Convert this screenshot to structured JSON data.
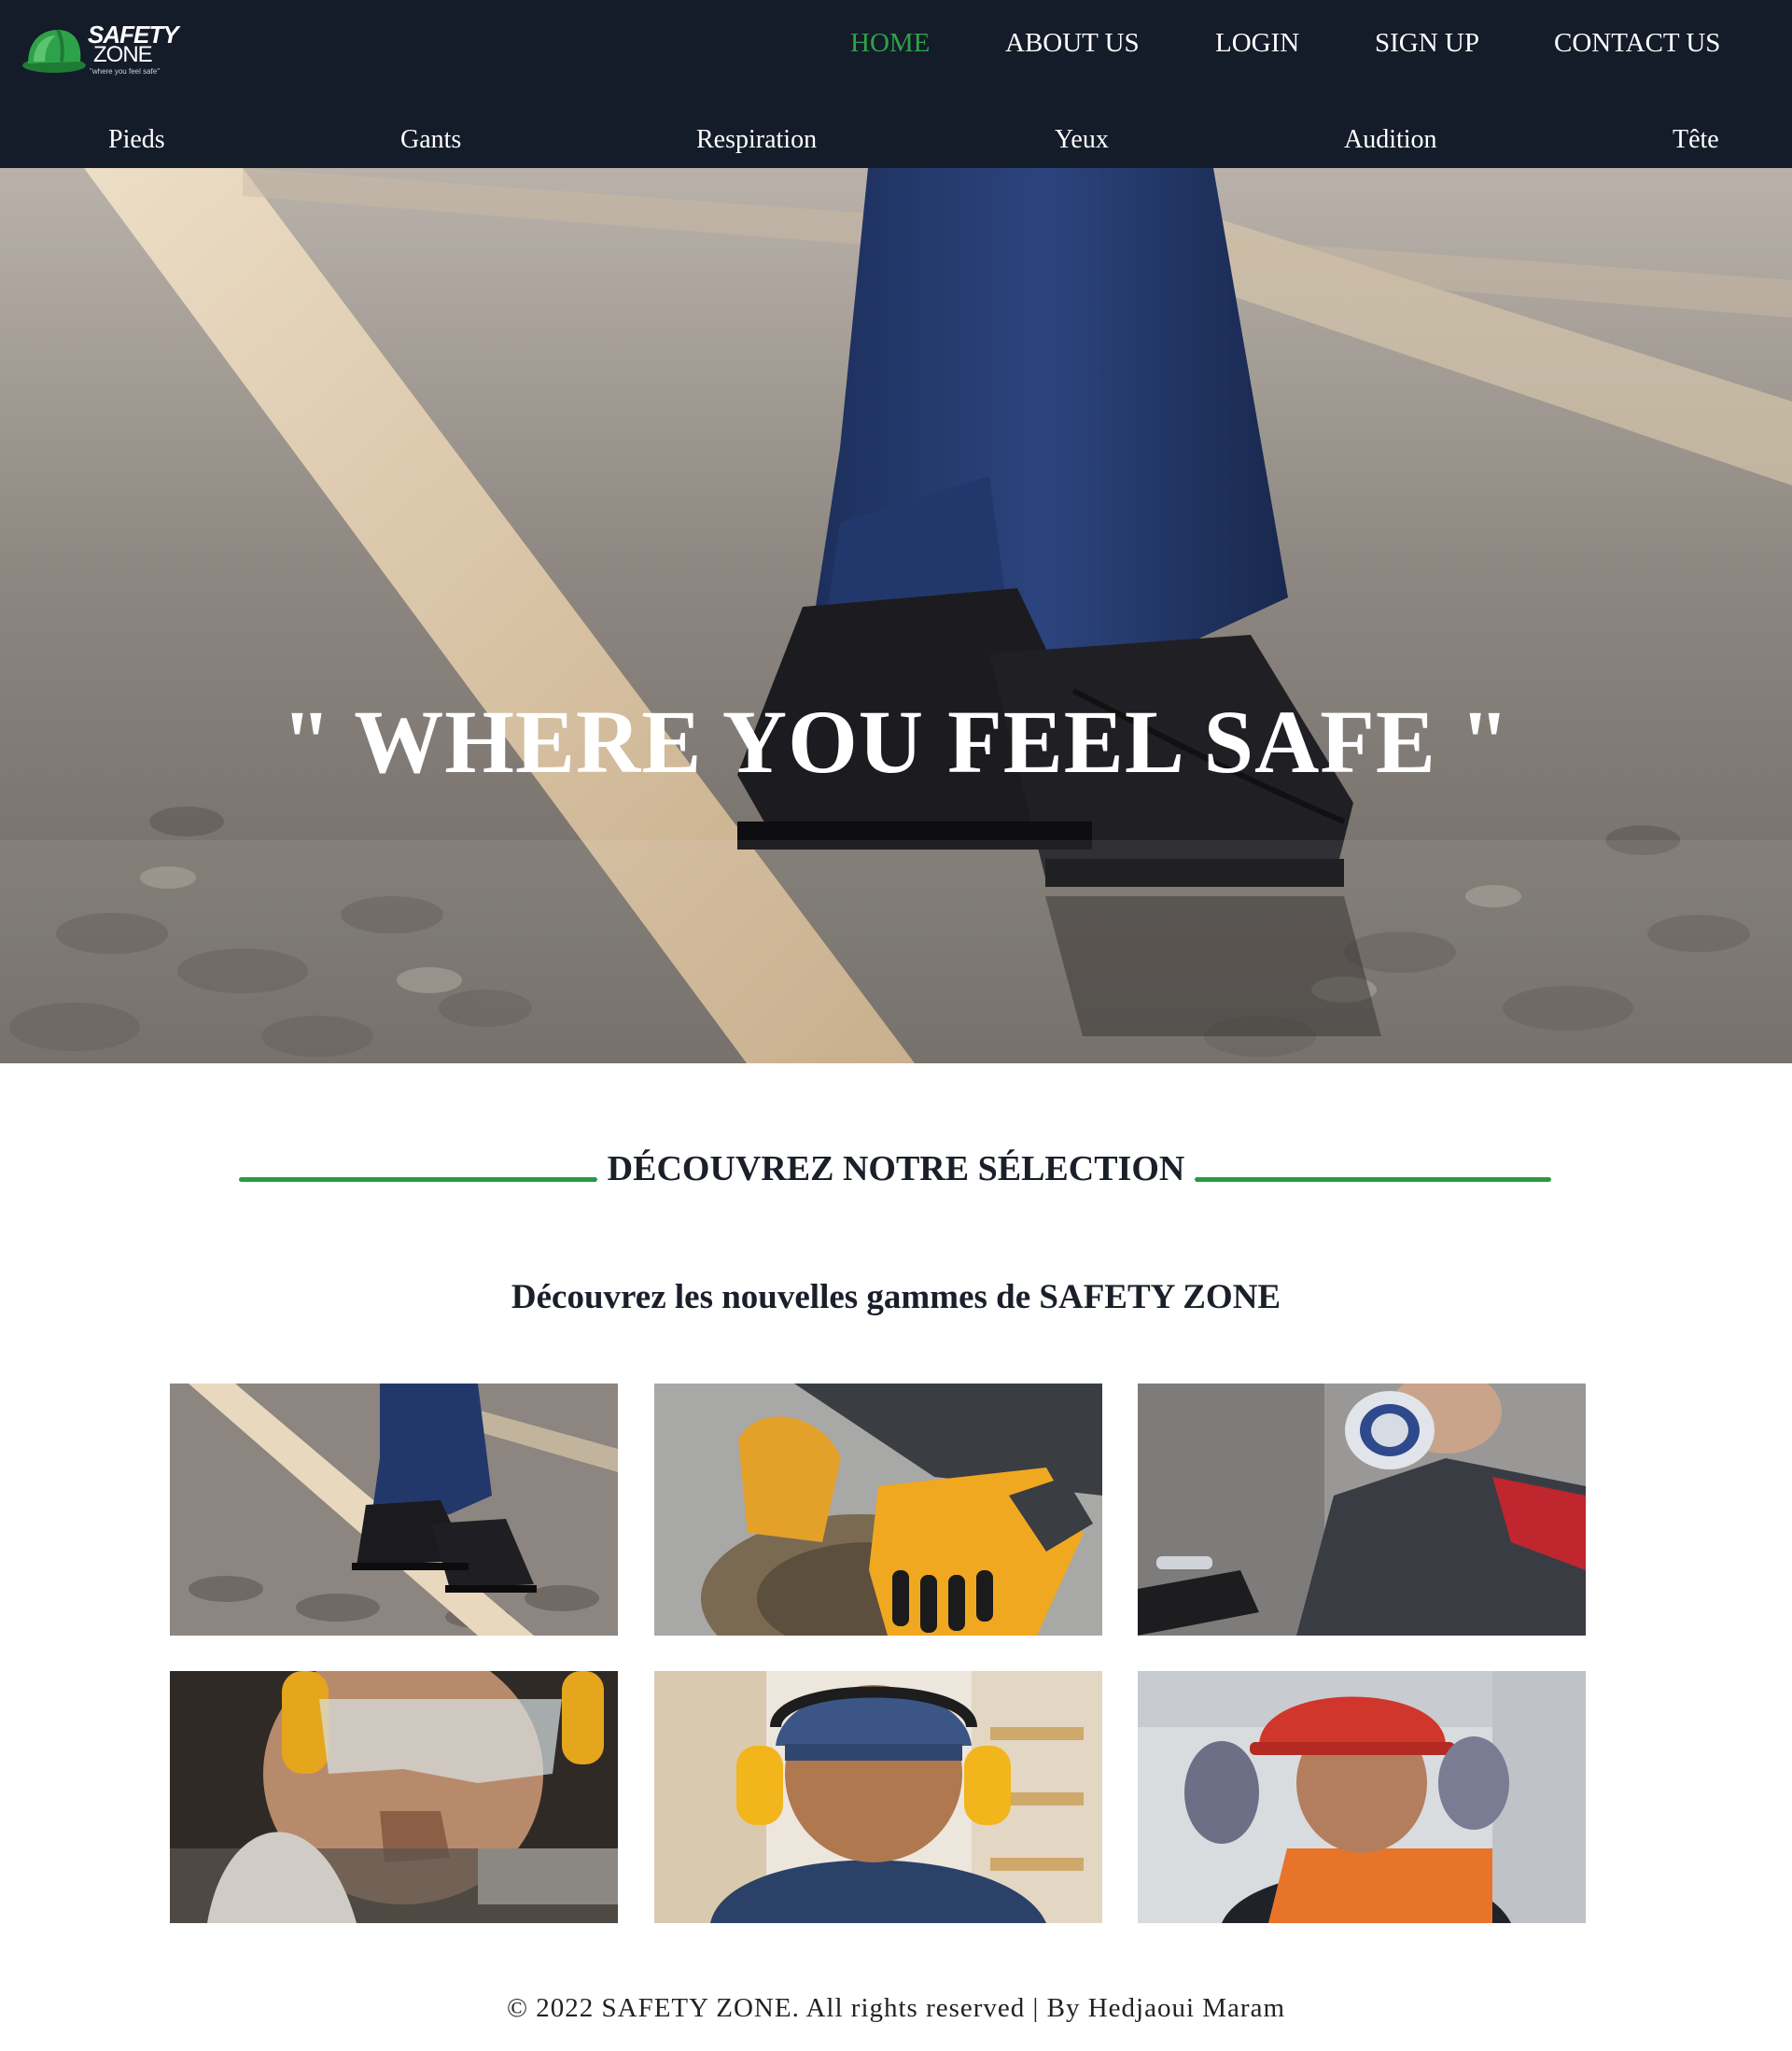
{
  "brand": {
    "name_line1": "SAFETY",
    "name_line2": "ZONE",
    "tagline": "\"where you feel safe\"",
    "colors": {
      "header_bg": "#141b29",
      "accent_green": "#2ea24a"
    }
  },
  "top_nav": [
    {
      "label": "HOME",
      "active": true
    },
    {
      "label": "ABOUT US",
      "active": false
    },
    {
      "label": "LOGIN",
      "active": false
    },
    {
      "label": "SIGN UP",
      "active": false
    },
    {
      "label": "CONTACT US",
      "active": false
    }
  ],
  "category_nav": [
    {
      "label": "Pieds"
    },
    {
      "label": "Gants"
    },
    {
      "label": "Respiration"
    },
    {
      "label": "Yeux"
    },
    {
      "label": "Audition"
    },
    {
      "label": "Tête"
    }
  ],
  "hero": {
    "title": "\" WHERE YOU FEEL SAFE \"",
    "image": "safety-boots-on-rail-photo"
  },
  "selection": {
    "heading": "DÉCOUVREZ NOTRE SÉLECTION",
    "subtitle": "Découvrez les nouvelles gammes de SAFETY ZONE",
    "tiles": [
      {
        "image": "safety-boots-photo"
      },
      {
        "image": "work-gloves-photo"
      },
      {
        "image": "respirator-mask-photo"
      },
      {
        "image": "safety-goggles-earmuffs-photo"
      },
      {
        "image": "hearing-protection-earmuffs-photo"
      },
      {
        "image": "hard-hat-helmet-photo"
      }
    ]
  },
  "footer": {
    "text": "© 2022 SAFETY ZONE. All rights reserved | By Hedjaoui Maram"
  }
}
